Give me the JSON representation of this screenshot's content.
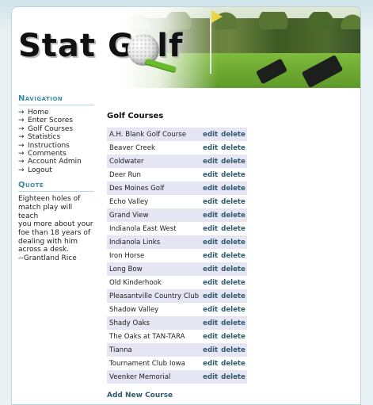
{
  "header": {
    "logo_text": "Stat Golf"
  },
  "sidebar": {
    "navigation_heading": "Navigation",
    "nav_items": [
      {
        "label": "Home"
      },
      {
        "label": "Enter Scores"
      },
      {
        "label": "Golf Courses"
      },
      {
        "label": "Statistics"
      },
      {
        "label": "Instructions"
      },
      {
        "label": "Comments"
      },
      {
        "label": "Account Admin"
      },
      {
        "label": "Logout"
      }
    ],
    "arrow_glyph": "→",
    "quote_heading": "Quote",
    "quote_lines": [
      "Eighteen holes of",
      "match play will teach",
      "you more about your",
      "foe than 18 years of",
      "dealing with him",
      "across a desk.",
      "--Grantland Rice"
    ]
  },
  "main": {
    "title": "Golf Courses",
    "edit_label": "edit",
    "delete_label": "delete",
    "courses": [
      "A.H. Blank Golf Course",
      "Beaver Creek",
      "Coldwater",
      "Deer Run",
      "Des Moines Golf",
      "Echo Valley",
      "Grand View",
      "Indianola East West",
      "Indianola Links",
      "Iron Horse",
      "Long Bow",
      "Old Kinderhook",
      "Pleasantville Country Club",
      "Shadow Valley",
      "Shady Oaks",
      "The Oaks at TAN-TARA",
      "Tianna",
      "Tournament Club Iowa",
      "Veenker Memorial"
    ],
    "add_new_label": "Add New Course"
  },
  "colors": {
    "heading_accent": "#3a8aa6",
    "action_link": "#2f5a6e",
    "row_stripe": "#e5e5f4",
    "tee_green": "#6abb2a"
  },
  "icons": [
    "golf-ball-icon",
    "golf-tee-icon",
    "arrow-right-icon"
  ]
}
